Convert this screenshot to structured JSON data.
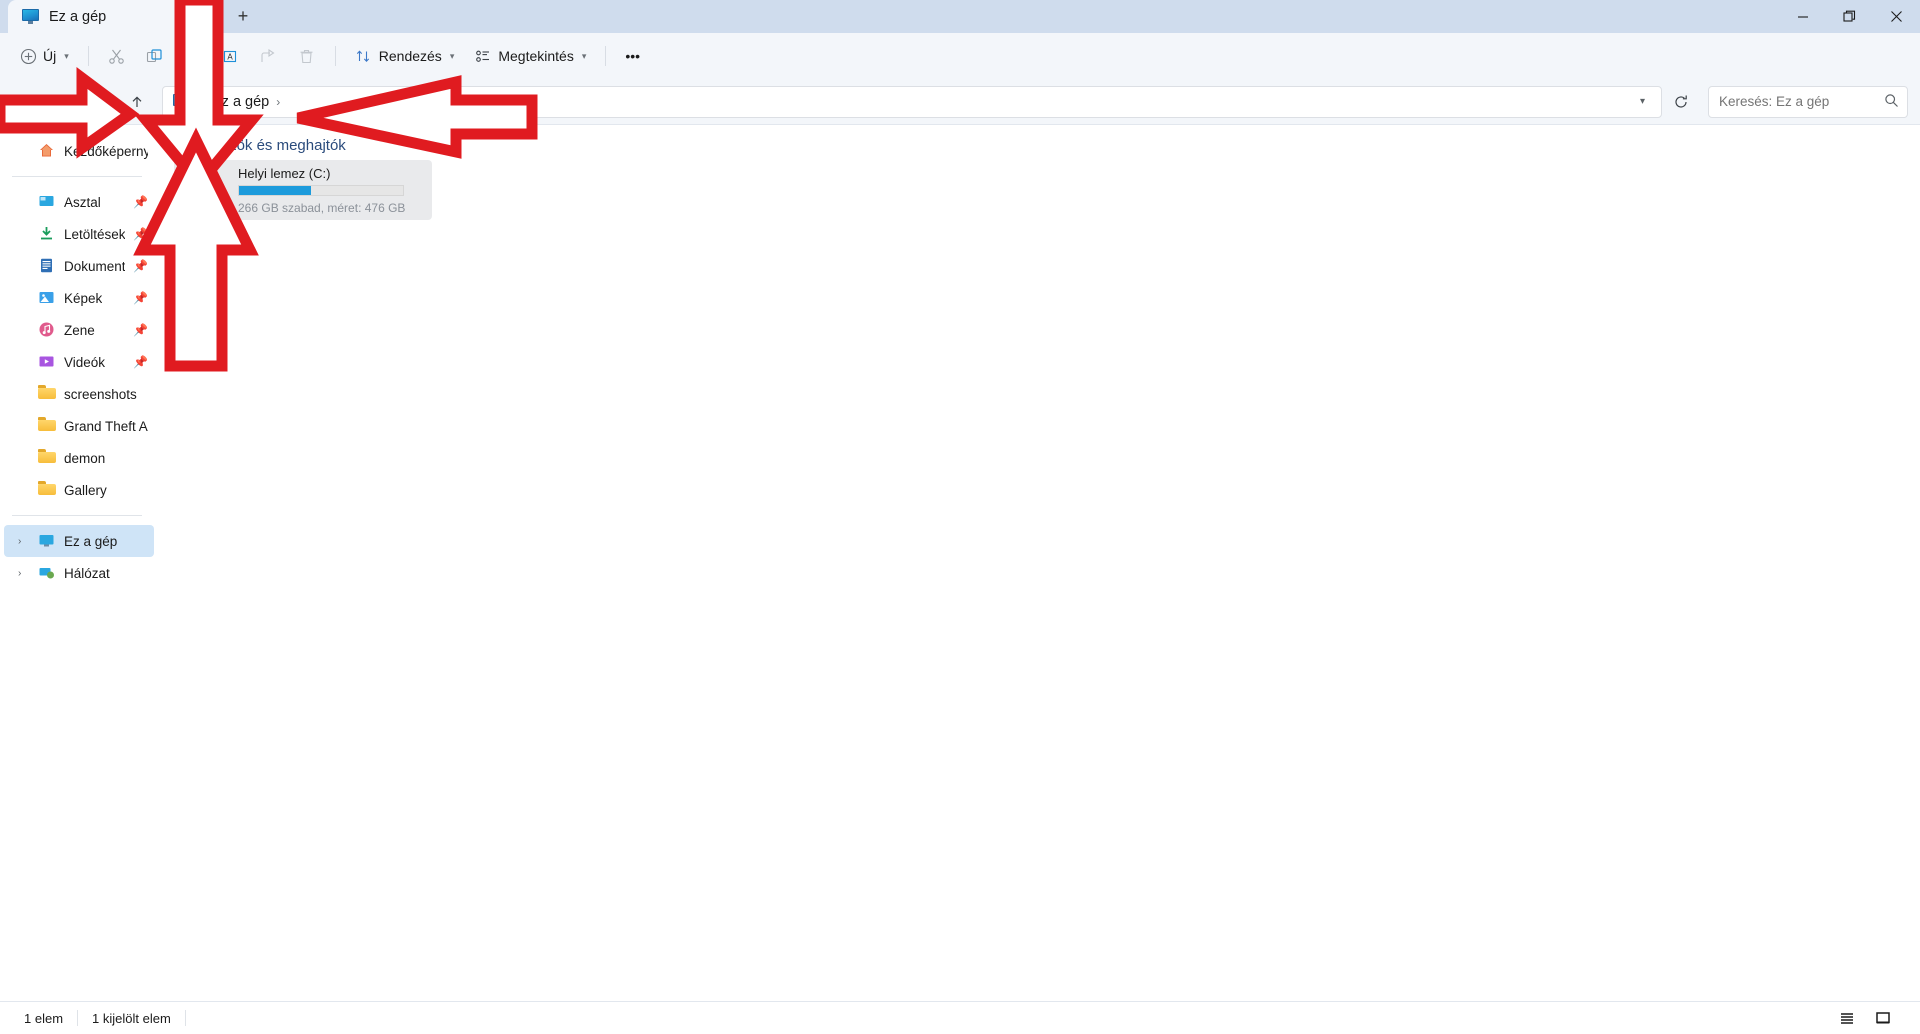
{
  "window": {
    "tab_title": "Ez a gép",
    "tab_icon": "this-pc-icon",
    "new_tab_label": "+",
    "close_tab_label": "✕",
    "controls": {
      "minimize": "minimize-icon",
      "restore": "restore-icon",
      "close": "close-icon"
    }
  },
  "toolbar": {
    "new_label": "Új",
    "sort_label": "Rendezés",
    "view_label": "Megtekintés",
    "overflow_label": "•••",
    "icons": [
      "cut-icon",
      "copy-icon",
      "paste-icon",
      "rename-icon",
      "share-icon",
      "delete-icon"
    ]
  },
  "address": {
    "back": "back-icon",
    "forward": "forward-icon",
    "recent": "chevron-down-icon",
    "up": "up-icon",
    "crumbs": [
      "Ez a gép"
    ],
    "separator": "›",
    "dropdown": "chevron-down-icon",
    "refresh": "refresh-icon"
  },
  "search": {
    "placeholder": "Keresés: Ez a gép",
    "value": "",
    "icon": "search-icon"
  },
  "sidebar": {
    "home": {
      "label": "Kezdőképernyő",
      "icon": "home-icon"
    },
    "quick": [
      {
        "label": "Asztal",
        "icon": "desktop-icon",
        "pinned": true
      },
      {
        "label": "Letöltések",
        "icon": "downloads-icon",
        "pinned": true
      },
      {
        "label": "Dokumentumok",
        "icon": "documents-icon",
        "pinned": true
      },
      {
        "label": "Képek",
        "icon": "pictures-icon",
        "pinned": true
      },
      {
        "label": "Zene",
        "icon": "music-icon",
        "pinned": true
      },
      {
        "label": "Videók",
        "icon": "videos-icon",
        "pinned": true
      },
      {
        "label": "screenshots",
        "icon": "folder-icon",
        "pinned": false
      },
      {
        "label": "Grand Theft Auto S",
        "icon": "folder-icon",
        "pinned": false
      },
      {
        "label": "demon",
        "icon": "folder-icon",
        "pinned": false
      },
      {
        "label": "Gallery",
        "icon": "folder-icon",
        "pinned": false
      }
    ],
    "roots": [
      {
        "label": "Ez a gép",
        "icon": "this-pc-icon",
        "selected": true,
        "expander": "›"
      },
      {
        "label": "Hálózat",
        "icon": "network-icon",
        "selected": false,
        "expander": "›"
      }
    ]
  },
  "content": {
    "group_title": "Eszközök és meghajtók",
    "group_chevron": "chevron-down-icon",
    "drives": [
      {
        "name": "Helyi lemez (C:)",
        "details": "266 GB szabad, méret: 476 GB",
        "used_percent": 44,
        "free_gb": 266,
        "size_gb": 476,
        "icon": "local-disk-icon",
        "bar_color": "#1d9bdc"
      }
    ]
  },
  "statusbar": {
    "item_count": "1 elem",
    "selected_count": "1 kijelölt elem",
    "view_details": "details-view-icon",
    "view_large": "large-icons-icon"
  },
  "annotations": {
    "color": "#e01b20",
    "arrows": [
      {
        "name": "arrow-pointing-at-breadcrumb",
        "direction": "down"
      },
      {
        "name": "arrow-pointing-at-drive-tile",
        "direction": "up"
      },
      {
        "name": "arrow-pointing-at-navigation-buttons",
        "direction": "right"
      },
      {
        "name": "arrow-pointing-at-address-bar",
        "direction": "left"
      }
    ]
  }
}
